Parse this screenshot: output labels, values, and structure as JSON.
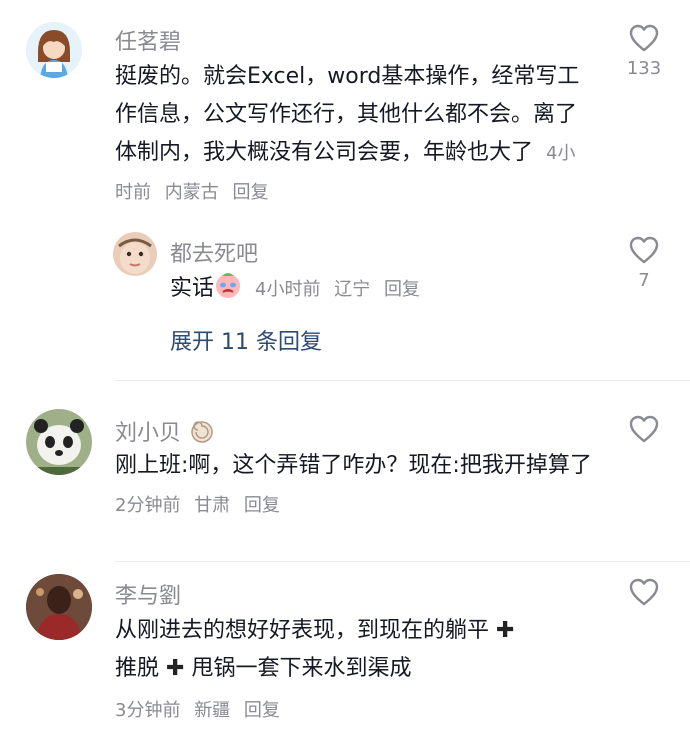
{
  "comments": [
    {
      "user": "任茗碧",
      "text": "挺废的。就会Excel，word基本操作，经常写工作信息，公文写作还行，其他什么都不会。离了体制内，我大概没有公司会要，年龄也大了",
      "time": "4小时前",
      "location": "内蒙古",
      "reply_label": "回复",
      "likes": "133",
      "replies": [
        {
          "user": "都去死吧",
          "text": "实话",
          "time": "4小时前",
          "location": "辽宁",
          "reply_label": "回复",
          "likes": "7"
        }
      ],
      "expand_label": "展开 11 条回复"
    },
    {
      "user": "刘小贝",
      "text": "刚上班:啊，这个弄错了咋办？现在:把我开掉算了",
      "time": "2分钟前",
      "location": "甘肃",
      "reply_label": "回复",
      "likes": ""
    },
    {
      "user": "李与劉",
      "text_parts": [
        "从刚进去的想好好表现，到现在的躺平",
        "推脱",
        "甩锅一套下来水到渠成"
      ],
      "time": "3分钟前",
      "location": "新疆",
      "reply_label": "回复",
      "likes": ""
    }
  ],
  "icons": {
    "like": "heart-outline-icon",
    "emoji": "crying-face-emoji",
    "snail": "snail-shell-emoji",
    "plus": "heavy-plus-icon"
  }
}
